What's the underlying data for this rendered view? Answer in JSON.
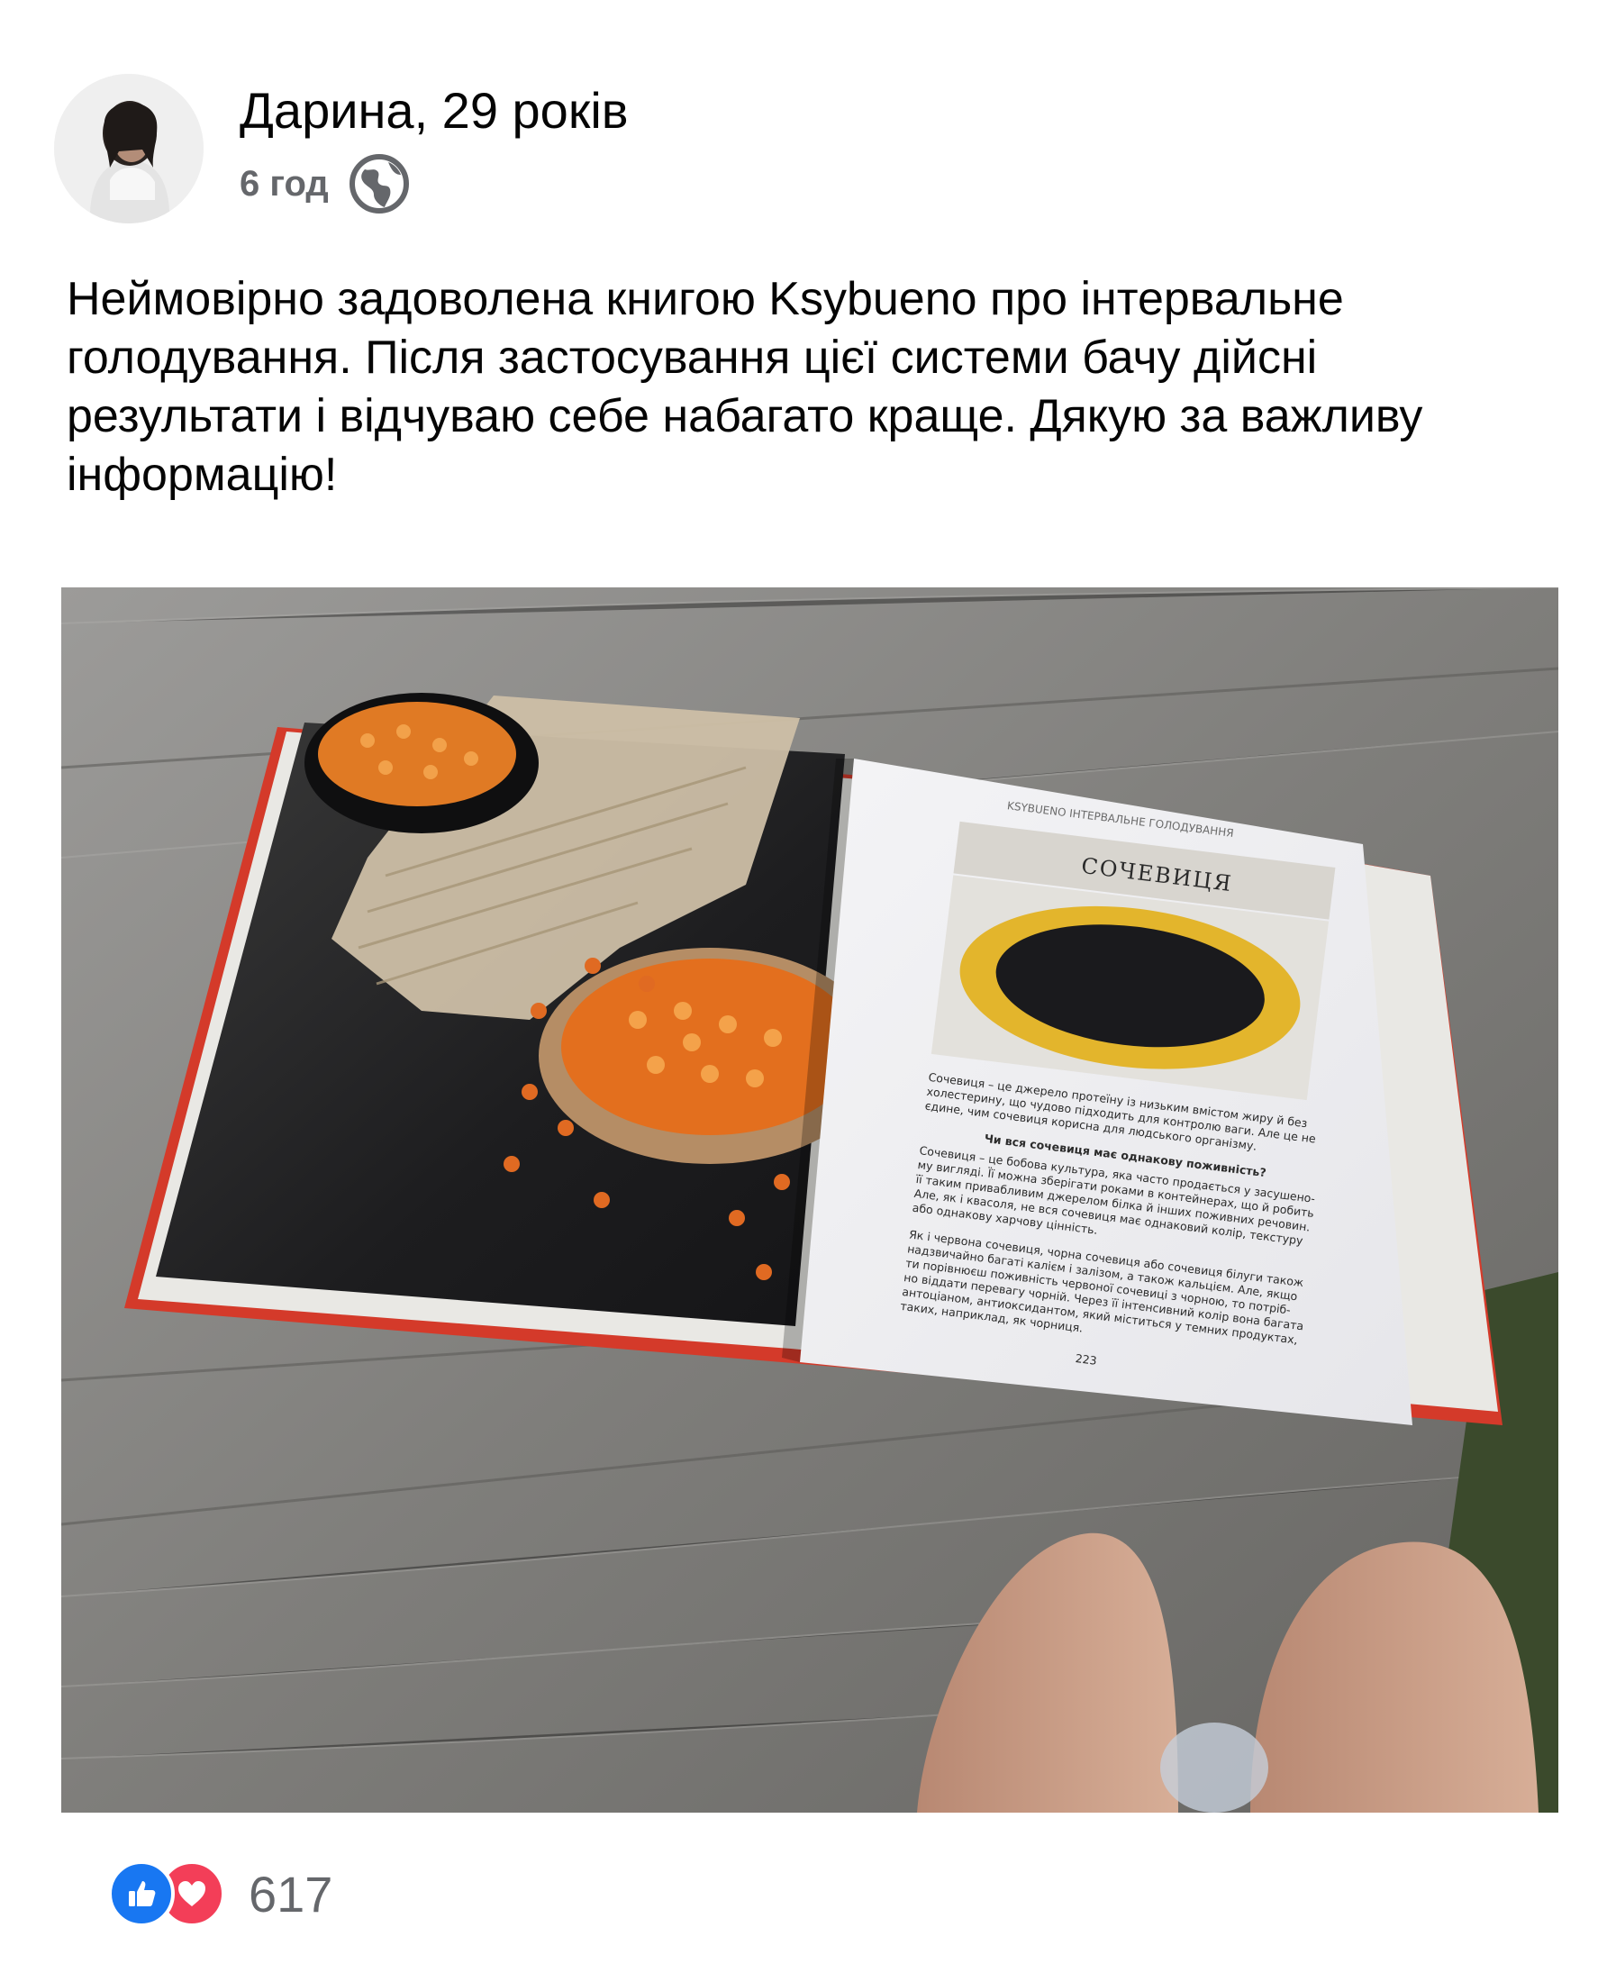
{
  "post": {
    "author": "Дарина, 29 років",
    "time": "6 год",
    "audience_icon": "globe-icon",
    "text": "Неймовірно задоволена книгою Ksybueno про інтервальне голодування. Після застосування цієї системи бачу дійсні результати і відчуваю себе набагато краще. Дякую за важливу інформацію!"
  },
  "book": {
    "running_head": "KSYBUENO ІНТЕРВАЛЬНЕ ГОЛОДУВАННЯ",
    "chapter_title": "СОЧЕВИЦЯ",
    "intro_lines": [
      "Сочевиця – це джерело протеїну із низьким вмістом жиру й без",
      "холестерину, що чудово підходить для контролю ваги. Але це не",
      "єдине, чим сочевиця корисна для людського організму."
    ],
    "subheading": "Чи вся сочевиця має однакову поживність?",
    "para1_lines": [
      "Сочевиця – це бобова культура, яка часто продається у засушено-",
      "му вигляді. Її можна зберігати роками в контейнерах, що й робить",
      "її таким привабливим джерелом білка й інших поживних речовин.",
      "Але, як і квасоля, не вся сочевиця має однаковий колір, текстуру",
      "або однакову харчову цінність."
    ],
    "para2_lines": [
      "Як і червона сочевиця, чорна сочевиця або сочевиця білуги також",
      "надзвичайно багаті калієм і залізом, а також кальцієм. Але, якщо",
      "ти порівнюєш поживність червоної сочевиці з чорною, то потріб-",
      "но віддати перевагу чорній. Через її інтенсивний колір вона багата",
      "антоціаном, антиоксидантом, який міститься у темних продуктах,",
      "таких, наприклад, як чорниця."
    ],
    "page_number": "223"
  },
  "reactions": {
    "icons": [
      "like-icon",
      "love-icon"
    ],
    "count": "617",
    "like_color": "#1877f2",
    "love_color": "#f33e58"
  }
}
